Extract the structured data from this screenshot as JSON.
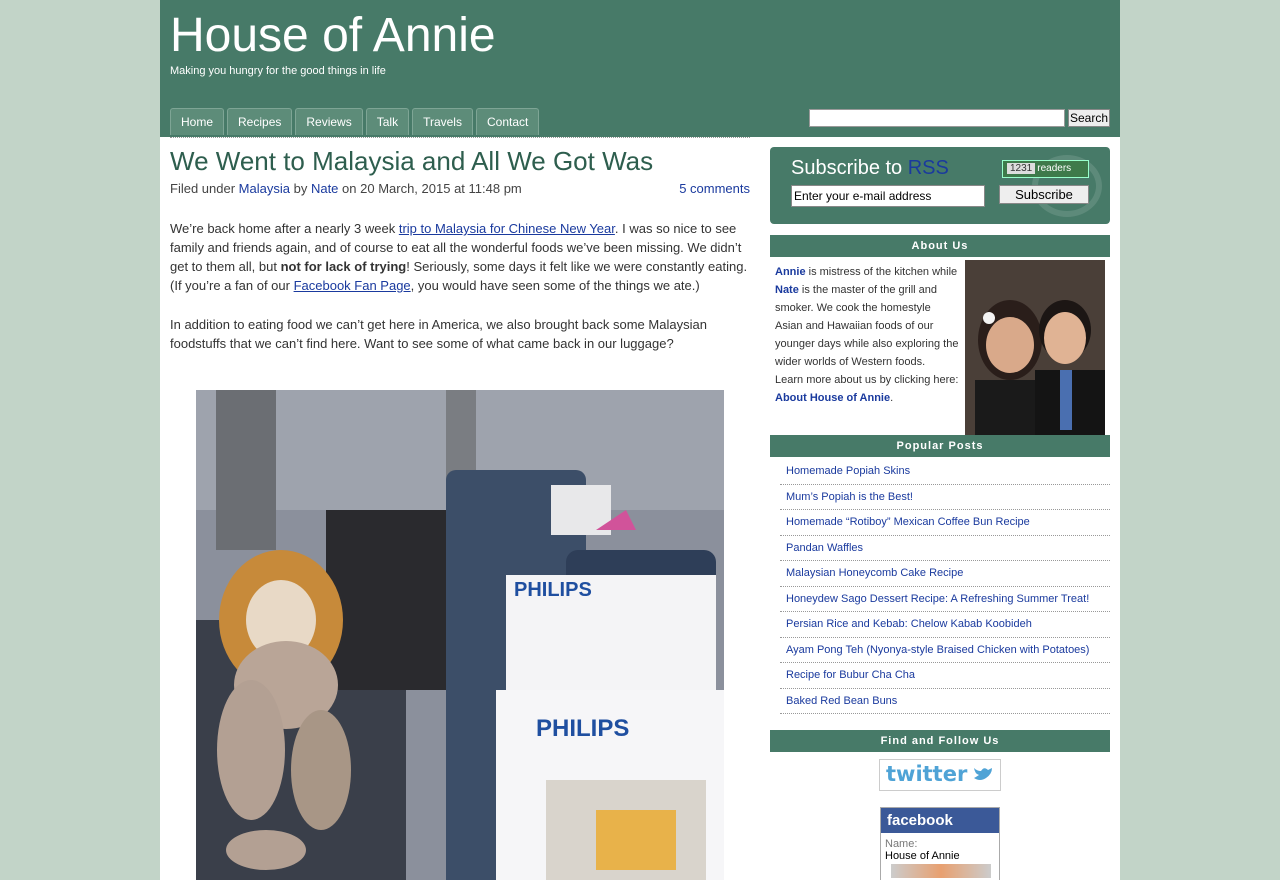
{
  "site": {
    "title": "House of Annie",
    "tagline": "Making you hungry for the good things in life"
  },
  "nav": [
    "Home",
    "Recipes",
    "Reviews",
    "Talk",
    "Travels",
    "Contact"
  ],
  "search": {
    "button_label": "Search",
    "value": ""
  },
  "post": {
    "title": "We Went to Malaysia and All We Got Was",
    "meta_filed": "Filed under",
    "meta_category": "Malaysia",
    "meta_by": "by",
    "meta_author": "Nate",
    "meta_date": "on 20 March, 2015 at 11:48 pm",
    "comments": "5 comments",
    "p1_a": "We’re back home after a nearly 3 week ",
    "p1_link": "trip to Malaysia for Chinese New Year",
    "p1_b": ". I was so nice to see family and friends again, and of course to eat all the wonderful foods we’ve been missing. We didn’t get to them all, but ",
    "p1_bold": "not for lack of trying",
    "p1_c": "! Seriously, some days it felt like we were constantly eating. (If you’re a fan of our ",
    "p1_link2": "Facebook Fan Page",
    "p1_d": ", you would have seen some of the things we ate.)",
    "p2": "In addition to eating food we can’t get here in America, we also brought back some Malaysian foodstuffs that we can’t find here. Want to see some of what came back in our luggage?",
    "photo_box_text1": "PHILIPS",
    "photo_box_text2": "PHILIPS"
  },
  "rss": {
    "title": "Subscribe to",
    "title_highlight": "RSS",
    "readers_count": "1231",
    "readers_label": "readers",
    "email_value": "Enter your e-mail address",
    "subscribe_label": "Subscribe"
  },
  "about": {
    "heading": "About Us",
    "annie": "Annie",
    "t1": " is mistress of the kitchen while ",
    "nate": "Nate",
    "t2": " is the master of the grill and smoker. We cook the homestyle Asian and Hawaiian foods of our younger days while also exploring the wider worlds of Western foods.",
    "t3": "Learn more about us by clicking here: ",
    "link": "About House of Annie",
    "t4": "."
  },
  "popular": {
    "heading": "Popular Posts",
    "items": [
      "Homemade Popiah Skins",
      "Mum’s Popiah is the Best!",
      "Homemade “Rotiboy” Mexican Coffee Bun Recipe",
      "Pandan Waffles",
      "Malaysian Honeycomb Cake Recipe",
      "Honeydew Sago Dessert Recipe: A Refreshing Summer Treat!",
      "Persian Rice and Kebab: Chelow Kabab Koobideh",
      "Ayam Pong Teh (Nyonya-style Braised Chicken with Potatoes)",
      "Recipe for Bubur Cha Cha",
      "Baked Red Bean Buns"
    ]
  },
  "follow": {
    "heading": "Find and Follow Us",
    "twitter_text": "twitter",
    "facebook_text": "facebook",
    "fb_name_label": "Name:",
    "fb_name": "House of Annie"
  },
  "colors": {
    "header": "#477a68",
    "background": "#c2d4c8",
    "link": "#1a3a9e",
    "title": "#2e5e4e"
  }
}
